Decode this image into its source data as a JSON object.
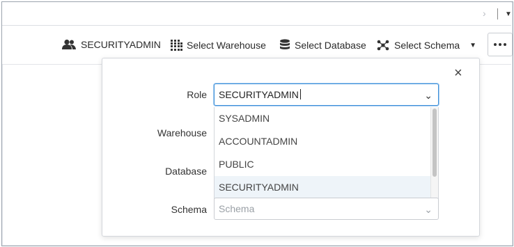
{
  "context_bar": {
    "role_label": "SECURITYADMIN",
    "warehouse_label": "Select Warehouse",
    "database_label": "Select Database",
    "schema_label": "Select Schema"
  },
  "popover": {
    "close_glyph": "×",
    "fields": {
      "role": {
        "label": "Role",
        "value": "SECURITYADMIN"
      },
      "warehouse": {
        "label": "Warehouse"
      },
      "database": {
        "label": "Database"
      },
      "schema": {
        "label": "Schema",
        "placeholder": "Schema"
      }
    },
    "role_options": [
      "SYSADMIN",
      "ACCOUNTADMIN",
      "PUBLIC",
      "SECURITYADMIN"
    ],
    "selected_option": "SECURITYADMIN"
  },
  "colors": {
    "focus_border": "#3b8fd9",
    "selected_row": "#eef4f9"
  }
}
